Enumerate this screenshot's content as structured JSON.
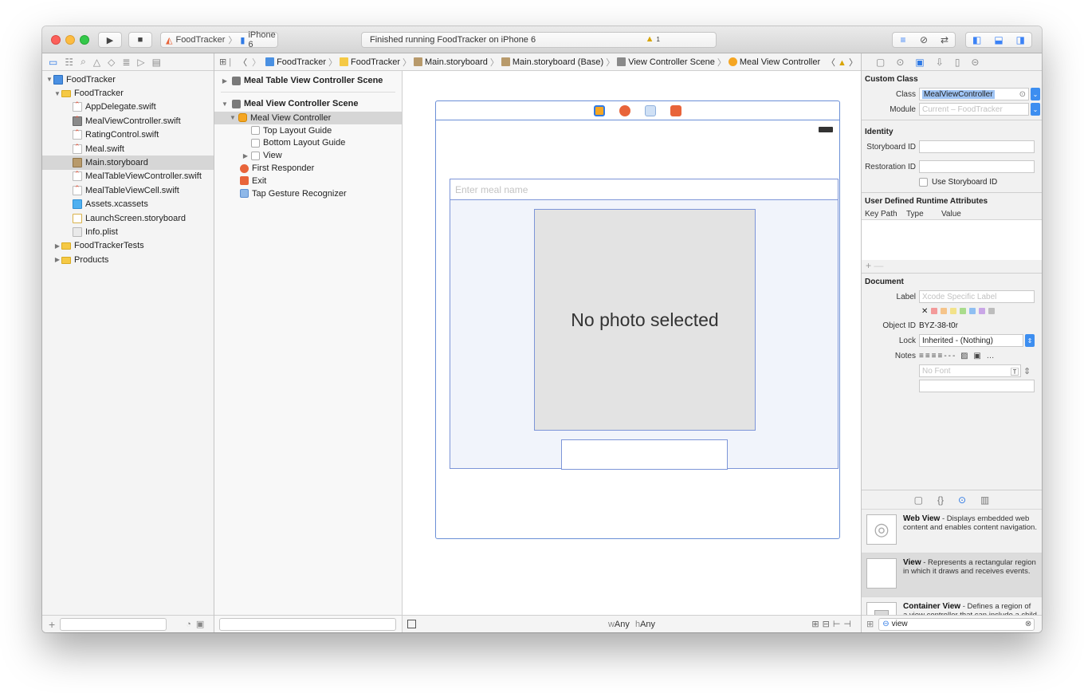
{
  "toolbar": {
    "scheme": "FoodTracker",
    "device": "iPhone 6",
    "status": "Finished running FoodTracker on iPhone 6",
    "warning_count": "1"
  },
  "navigator": {
    "items": [
      {
        "label": "FoodTracker",
        "icon": "project-icon"
      },
      {
        "label": "FoodTracker",
        "icon": "folder-icon"
      },
      {
        "label": "AppDelegate.swift",
        "icon": "swift-file-icon"
      },
      {
        "label": "MealViewController.swift",
        "icon": "swift-file-icon"
      },
      {
        "label": "RatingControl.swift",
        "icon": "swift-file-icon"
      },
      {
        "label": "Meal.swift",
        "icon": "swift-file-icon"
      },
      {
        "label": "Main.storyboard",
        "icon": "storyboard-icon"
      },
      {
        "label": "MealTableViewController.swift",
        "icon": "swift-file-icon"
      },
      {
        "label": "MealTableViewCell.swift",
        "icon": "swift-file-icon"
      },
      {
        "label": "Assets.xcassets",
        "icon": "assets-icon"
      },
      {
        "label": "LaunchScreen.storyboard",
        "icon": "storyboard-icon"
      },
      {
        "label": "Info.plist",
        "icon": "plist-icon"
      },
      {
        "label": "FoodTrackerTests",
        "icon": "folder-icon"
      },
      {
        "label": "Products",
        "icon": "folder-icon"
      }
    ]
  },
  "jumpbar": {
    "crumbs": [
      "FoodTracker",
      "FoodTracker",
      "Main.storyboard",
      "Main.storyboard (Base)",
      "View Controller Scene",
      "Meal View Controller"
    ]
  },
  "outline": {
    "scene1": "Meal Table View Controller Scene",
    "scene2": "Meal View Controller Scene",
    "items": [
      "Meal View Controller",
      "Top Layout Guide",
      "Bottom Layout Guide",
      "View",
      "First Responder",
      "Exit",
      "Tap Gesture Recognizer"
    ]
  },
  "canvas": {
    "name_placeholder": "Enter meal name",
    "photo_text": "No photo selected",
    "size_w": "w",
    "size_w_val": "Any",
    "size_h": "h",
    "size_h_val": "Any"
  },
  "inspector": {
    "custom_class_title": "Custom Class",
    "class_label": "Class",
    "class_value": "MealViewController",
    "module_label": "Module",
    "module_placeholder": "Current – FoodTracker",
    "identity_title": "Identity",
    "storyboard_id_label": "Storyboard ID",
    "restoration_id_label": "Restoration ID",
    "use_storyboard_id": "Use Storyboard ID",
    "udra_title": "User Defined Runtime Attributes",
    "col_keypath": "Key Path",
    "col_type": "Type",
    "col_value": "Value",
    "document_title": "Document",
    "label_label": "Label",
    "label_placeholder": "Xcode Specific Label",
    "object_id_label": "Object ID",
    "object_id_value": "BYZ-38-t0r",
    "lock_label": "Lock",
    "lock_value": "Inherited - (Nothing)",
    "notes_label": "Notes",
    "font_placeholder": "No Font"
  },
  "library": {
    "items": [
      {
        "title": "Web View",
        "desc": " - Displays embedded web content and enables content navigation."
      },
      {
        "title": "View",
        "desc": " - Represents a rectangular region in which it draws and receives events."
      },
      {
        "title": "Container View",
        "desc": " - Defines a region of a view controller that can include a child view controller."
      }
    ],
    "search_value": "view"
  },
  "colors": {
    "accent": "#2f7ae5",
    "close": "#fc605b",
    "minimize": "#fdbc40",
    "maximize": "#34c84a",
    "view_controller_icon": "#f5a623",
    "first_responder_icon": "#e8643a"
  }
}
